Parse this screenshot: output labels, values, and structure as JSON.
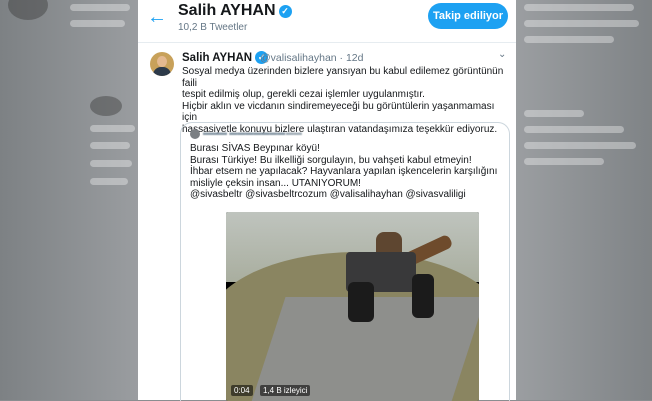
{
  "header": {
    "name": "Salih AYHAN",
    "tweet_count": "10,2 B Tweetler",
    "follow_label": "Takip ediliyor"
  },
  "tweet": {
    "name": "Salih AYHAN",
    "handle": "@valisalihayhan · 12d",
    "lines": [
      "Sosyal medya üzerinden bizlere yansıyan bu kabul edilemez görüntünün faili",
      "tespit edilmiş olup, gerekli cezai işlemler uygulanmıştır.",
      "Hiçbir aklın ve vicdanın sindiremeyeceği bu görüntülerin yaşanmaması için",
      "hassasiyetle konuyu bizlere ulaştıran vatandaşımıza teşekkür ediyoruz."
    ]
  },
  "quote": {
    "lines": [
      "Burası SİVAS Beypınar köyü!",
      "Burası Türkiye! Bu ilkelliği sorgulayın, bu vahşeti kabul etmeyin!",
      "İhbar etsem ne yapılacak? Hayvanlara yapılan işkencelerin karşılığını",
      "misliyle çeksin insan... UTANIYORUM!",
      "@sivasbeltr @sivasbeltrcozum  @valisalihayhan @sivasvaliligi"
    ],
    "video_time": "0:04",
    "video_views": "1,4 B izleyici"
  },
  "colors": {
    "accent": "#1da1f2",
    "text": "#14171a",
    "muted": "#657786"
  }
}
